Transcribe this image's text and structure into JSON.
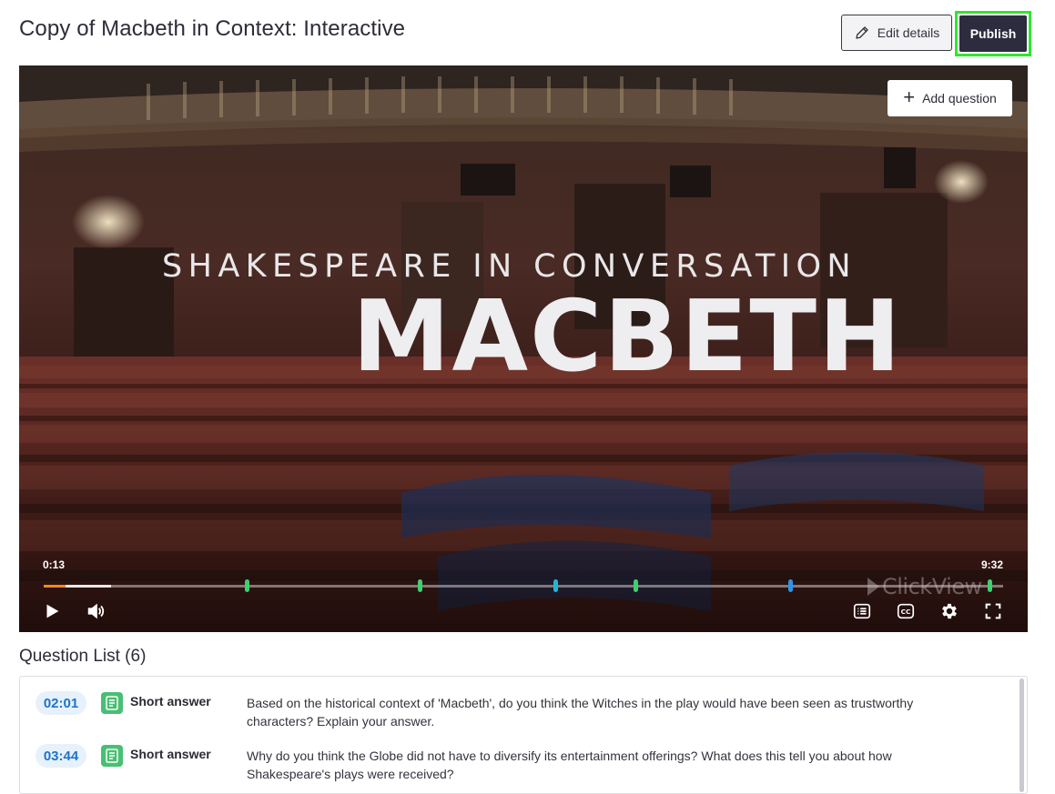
{
  "page": {
    "title": "Copy of Macbeth in Context: Interactive",
    "edit_label": "Edit details",
    "publish_label": "Publish"
  },
  "video": {
    "add_question_label": "Add question",
    "overlay_subtitle": "SHAKESPEARE IN CONVERSATION",
    "overlay_title": "MACBETH",
    "current_time": "0:13",
    "total_time": "9:32",
    "watermark": "ClickView",
    "progress_played_fraction": 0.023,
    "progress_buffered_fraction": 0.07,
    "markers": [
      {
        "time_seconds": 121,
        "color": "#3ecf6e"
      },
      {
        "time_seconds": 224,
        "color": "#3ecf6e"
      },
      {
        "time_seconds": 305,
        "color": "#25b6d6"
      },
      {
        "time_seconds": 353,
        "color": "#3ecf6e"
      },
      {
        "time_seconds": 445,
        "color": "#2f93e6"
      },
      {
        "time_seconds": 564,
        "color": "#3ecf6e"
      }
    ],
    "controls": {
      "play_icon": "play-icon",
      "volume_icon": "volume-icon",
      "transcript_icon": "transcript-icon",
      "captions_icon": "captions-icon",
      "settings_icon": "gear-icon",
      "fullscreen_icon": "fullscreen-icon"
    }
  },
  "question_list": {
    "title": "Question List (6)",
    "items": [
      {
        "time": "02:01",
        "type": "Short answer",
        "text": "Based on the historical context of 'Macbeth', do you think the Witches in the play would have been seen as trustworthy characters? Explain your answer."
      },
      {
        "time": "03:44",
        "type": "Short answer",
        "text": "Why do you think the Globe did not have to diversify its entertainment offerings? What does this tell you about how Shakespeare's plays were received?"
      }
    ]
  },
  "colors": {
    "publish_bg": "#2c2c3e",
    "highlight": "#2ee62e",
    "progress": "#f08a1c",
    "time_badge": "#1f73c7",
    "question_icon": "#49bf74"
  }
}
